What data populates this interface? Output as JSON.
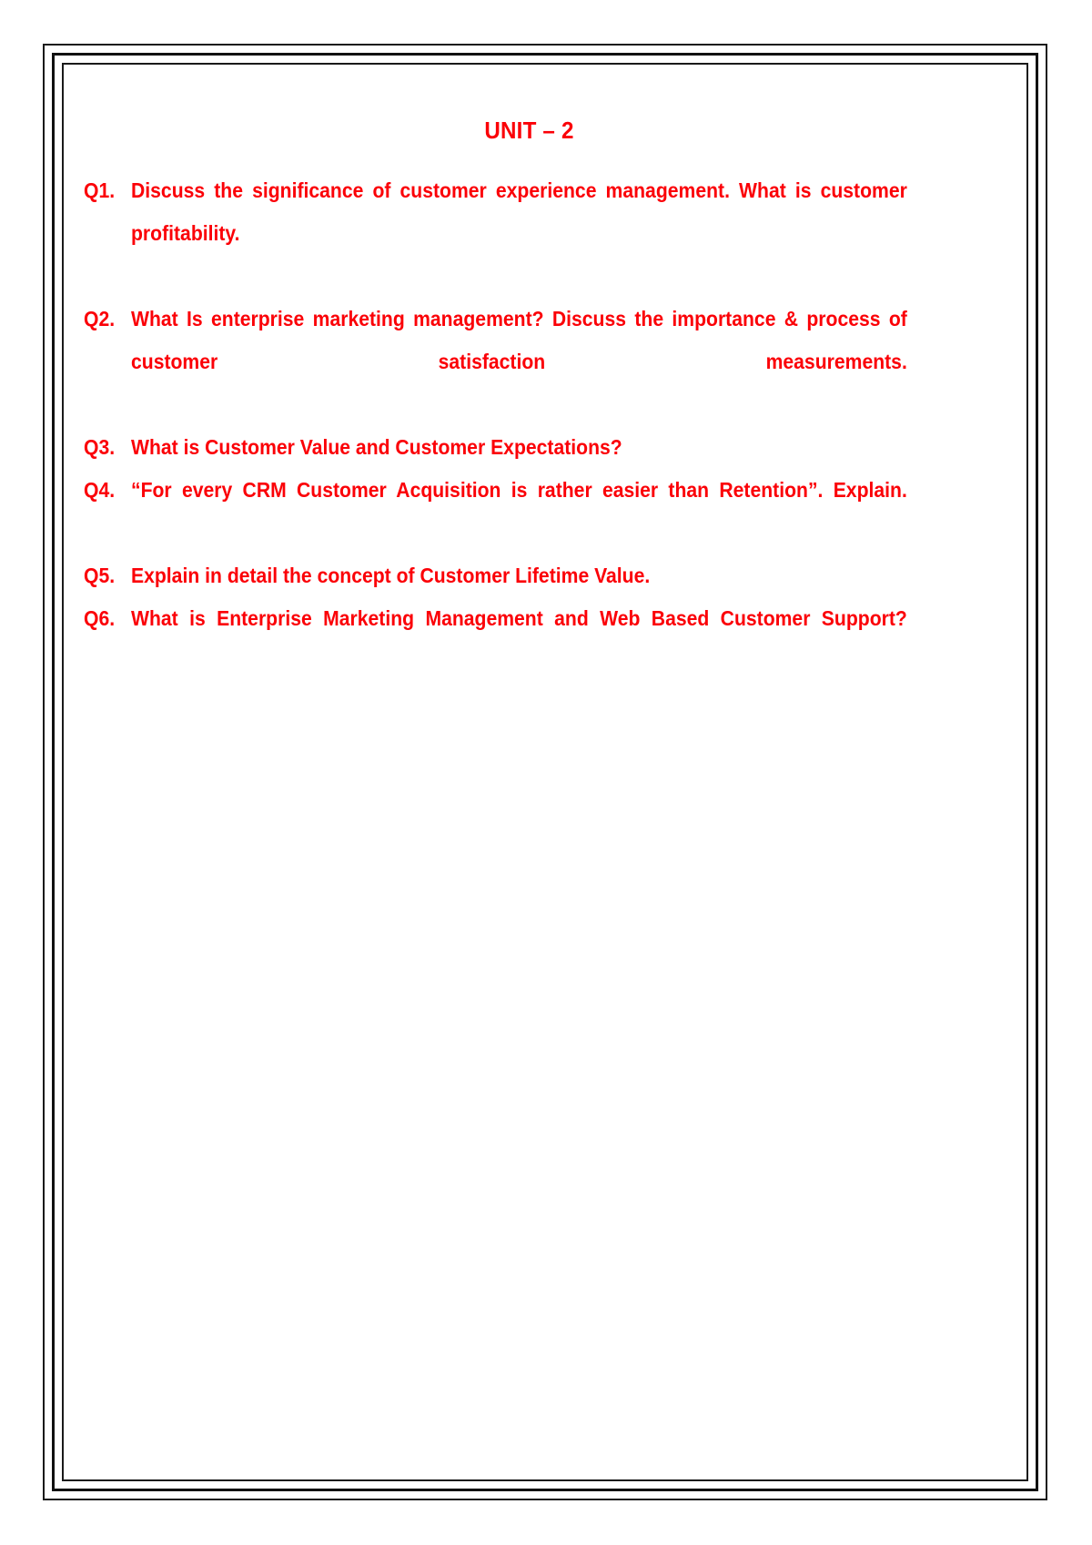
{
  "document": {
    "title": "UNIT – 2",
    "text_color": "#fb0007",
    "border_color": "#1a1a1a",
    "background_color": "#ffffff",
    "questions": [
      {
        "label": "Q1.",
        "text": "Discuss the significance of customer experience management. What is customer profitability.",
        "justify_full": true
      },
      {
        "label": "Q2.",
        "text": "What Is enterprise marketing management? Discuss the importance & process of customer satisfaction measurements.",
        "justify_full": true
      },
      {
        "label": "Q3.",
        "text": "What is Customer Value and Customer Expectations?",
        "justify_full": false
      },
      {
        "label": "Q4.",
        "text": "“For every CRM Customer Acquisition is rather easier than Retention”. Explain.",
        "justify_full": true
      },
      {
        "label": "Q5.",
        "text": "Explain in detail the concept of Customer Lifetime Value.",
        "justify_full": false
      },
      {
        "label": "Q6.",
        "text": "What is Enterprise Marketing Management and Web Based Customer Support?",
        "justify_full": true
      }
    ]
  }
}
